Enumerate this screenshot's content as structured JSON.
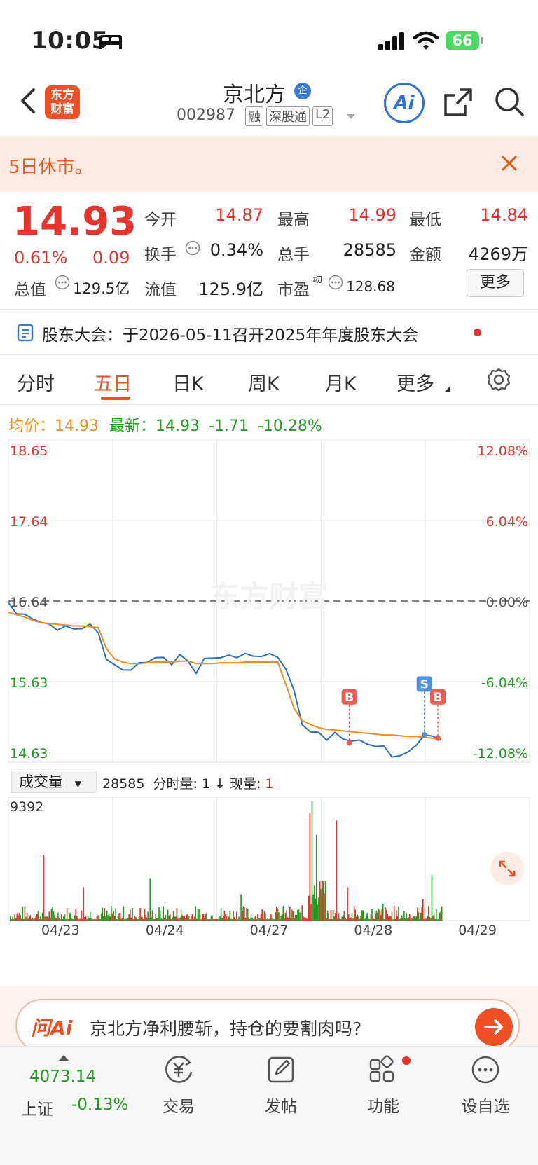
{
  "status_bar": {
    "time": "10:05",
    "battery": "66"
  },
  "header": {
    "back_icon": "chevron-left-icon",
    "logo_text": "东方财富",
    "stock_name": "京北方",
    "enterprise_badge": "企",
    "code": "002987",
    "tags": [
      "融",
      "深股通",
      "L2"
    ],
    "ai_label": "Ai"
  },
  "notice": {
    "text": "5日休市。"
  },
  "quote": {
    "price": "14.93",
    "change_pct": "0.61%",
    "change_abs": "0.09",
    "open_label": "今开",
    "open": "14.87",
    "high_label": "最高",
    "high": "14.99",
    "low_label": "最低",
    "low": "14.84",
    "turnover_label": "换手",
    "turnover": "0.34%",
    "volume_label": "总手",
    "volume": "28585",
    "amount_label": "金额",
    "amount": "4269万",
    "mktcap_label": "总值",
    "mktcap": "129.5亿",
    "float_label": "流值",
    "float_cap": "125.9亿",
    "pe_label": "市盈",
    "pe_sup": "动",
    "pe": "128.68",
    "more_button": "更多"
  },
  "meeting": {
    "text": "股东大会：于2026-05-11召开2025年年度股东大会"
  },
  "tabs": [
    {
      "label": "分时",
      "active": false
    },
    {
      "label": "五日",
      "active": true
    },
    {
      "label": "日K",
      "active": false
    },
    {
      "label": "周K",
      "active": false
    },
    {
      "label": "月K",
      "active": false
    },
    {
      "label": "更多",
      "active": false
    }
  ],
  "legend": {
    "avg_label": "均价：",
    "avg": "14.93",
    "latest_label": "最新：",
    "latest": "14.93",
    "latest_change": "-1.71",
    "latest_pct": "-10.28%"
  },
  "chart_data": {
    "type": "line",
    "price_ticks_left": [
      "18.65",
      "17.64",
      "16.64",
      "15.63",
      "14.63"
    ],
    "pct_ticks_right": [
      "12.08%",
      "6.04%",
      "0.00%",
      "-6.04%",
      "-12.08%"
    ],
    "ylim": [
      14.63,
      18.65
    ],
    "prev_close": 16.64,
    "x_dates": [
      "04/23",
      "04/24",
      "04/27",
      "04/28",
      "04/29"
    ],
    "series": [
      {
        "color": "#2a6fc4",
        "values": [
          16.62,
          16.5,
          16.45,
          16.43,
          16.38,
          16.33,
          16.3,
          16.32,
          16.28,
          16.32,
          16.33,
          16.25,
          15.93,
          15.82,
          15.8,
          15.78,
          15.85,
          15.9,
          15.92,
          15.93,
          15.87,
          15.95,
          15.9,
          15.75,
          15.9,
          15.95,
          15.93,
          15.95,
          15.96,
          15.97,
          15.95,
          15.97,
          15.96,
          15.95,
          15.8,
          15.5,
          15.12,
          15.0,
          14.99,
          14.93,
          14.98,
          14.92,
          14.91,
          14.88,
          14.87,
          14.83,
          14.81,
          14.72,
          14.7,
          14.75,
          14.87,
          14.95,
          14.96,
          14.92
        ]
      },
      {
        "color": "#f08c1e",
        "values": [
          16.5,
          16.47,
          16.44,
          16.4,
          16.37,
          16.36,
          16.35,
          16.34,
          16.33,
          16.33,
          16.32,
          16.31,
          16.05,
          15.92,
          15.88,
          15.86,
          15.86,
          15.87,
          15.88,
          15.88,
          15.88,
          15.89,
          15.89,
          15.86,
          15.86,
          15.86,
          15.87,
          15.87,
          15.87,
          15.88,
          15.88,
          15.88,
          15.88,
          15.88,
          15.6,
          15.3,
          15.15,
          15.1,
          15.06,
          15.04,
          15.03,
          15.02,
          15.01,
          15.0,
          14.99,
          14.98,
          14.97,
          14.97,
          14.96,
          14.95,
          14.95,
          14.94,
          14.93,
          14.93
        ]
      }
    ],
    "markers": [
      {
        "label": "B",
        "price": 14.87
      },
      {
        "label": "S",
        "price": 14.97
      },
      {
        "label": "B",
        "price": 14.93
      }
    ]
  },
  "volume": {
    "selector": "成交量",
    "total": "28585",
    "fenshi_label": "分时量:",
    "fenshi": "1",
    "xianliang_label": "现量:",
    "xianliang": "1",
    "max_tick": "9392",
    "max": 9392
  },
  "ai_bar": {
    "brand": "问Ai",
    "question": "京北方净利腰斩，持仓的要割肉吗?"
  },
  "bottom": {
    "index_value": "4073.14",
    "index_name": "上证",
    "index_change": "-0.13%",
    "items": [
      {
        "label": "交易",
        "icon": "yen-cycle-icon"
      },
      {
        "label": "发帖",
        "icon": "edit-icon"
      },
      {
        "label": "功能",
        "icon": "apps-icon"
      },
      {
        "label": "设自选",
        "icon": "more-circle-icon"
      }
    ]
  }
}
